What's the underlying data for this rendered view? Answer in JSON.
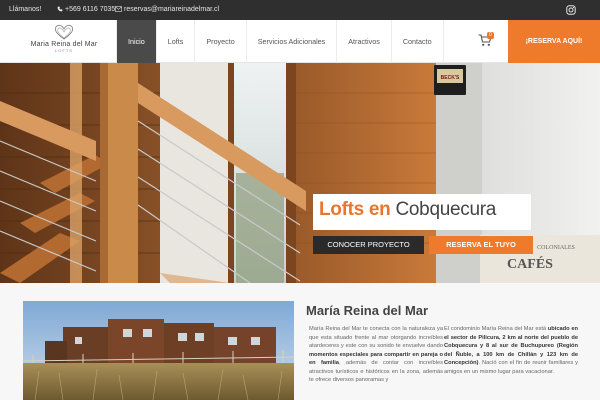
{
  "topbar": {
    "call_label": "Llámanos!",
    "phone": "+569 6116 7035",
    "email": "reservas@mariareinadelmar.cl"
  },
  "brand": {
    "name": "Maria Reina del Mar",
    "tagline": "LOFTS"
  },
  "nav": {
    "items": [
      "Inicio",
      "Lofts",
      "Proyecto",
      "Servicios Adicionales",
      "Atractivos",
      "Contacto"
    ],
    "active": "Inicio"
  },
  "cart": {
    "count": "0"
  },
  "header_cta": "¡RESERVA AQUÍ!",
  "hero": {
    "headline_bold": "Lofts en",
    "headline_light": "Cobquecura",
    "btn_primary": "CONOCER PROYECTO",
    "btn_secondary": "RESERVA EL TUYO",
    "wall_sign": "BECK'S",
    "cafe_sign_top": "COLONIALES",
    "cafe_sign_main": "CAFÉS"
  },
  "about": {
    "title": "María Reina del Mar",
    "col1_a": "María Reina del Mar te conecta con la naturaleza ya que esta situado frente al mar otorgando increíbles atardeceres y este con su sonido te envuelve dando ",
    "col1_b": "momentos especiales para compartir en pareja o en familia",
    "col1_c": ", además de contar con increíbles atractivos turísticos e históricos en la zona, además te ofrece diversos panoramas y",
    "col2_a": "El condominio María Reina del Mar está ",
    "col2_b": "ubicado en el sector de Pilicura, 2 km al norte del pueblo de Cobquecura y 8 al sur de Buchupureo (Región del Ñuble, a 100 km de Chillán y 123 km de Concepción)",
    "col2_c": ". Nació con el fin de reunir familiares y amigos en un mismo lugar para vacacionar."
  },
  "colors": {
    "accent": "#ee7a2c",
    "topbar": "#2f2f2f",
    "nav_active": "#4a4a4a"
  }
}
